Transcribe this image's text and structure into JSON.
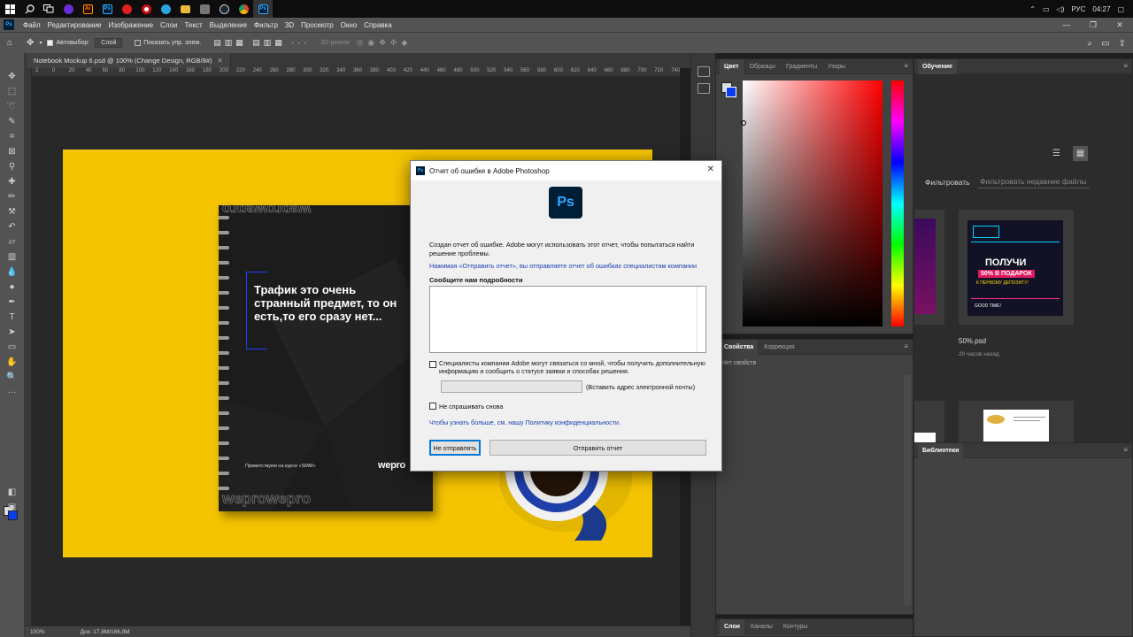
{
  "taskbar": {
    "apps": [
      {
        "icon": "windows-start-icon",
        "color": "#0d0d0d",
        "label": ""
      },
      {
        "icon": "search-icon",
        "color": "#0d0d0d",
        "label": ""
      },
      {
        "icon": "task-view-icon",
        "color": "#0d0d0d",
        "label": ""
      },
      {
        "icon": "app-purple-icon",
        "color": "#6a2bd9",
        "label": ""
      },
      {
        "icon": "illustrator-icon",
        "color": "#330000",
        "label": "Ai"
      },
      {
        "icon": "photoshop-icon",
        "color": "#001e36",
        "label": "Ps"
      },
      {
        "icon": "app-red-icon",
        "color": "#e02020",
        "label": ""
      },
      {
        "icon": "opera-icon",
        "color": "#cc0f16",
        "label": ""
      },
      {
        "icon": "telegram-icon",
        "color": "#2aa3df",
        "label": ""
      },
      {
        "icon": "folder-icon",
        "color": "#e8b93a",
        "label": ""
      },
      {
        "icon": "app-gray-icon",
        "color": "#555555",
        "label": ""
      },
      {
        "icon": "steam-icon",
        "color": "#1b2838",
        "label": ""
      },
      {
        "icon": "chrome-icon",
        "color": "#e0a800",
        "label": ""
      },
      {
        "icon": "photoshop-active-icon",
        "color": "#001e36",
        "label": "Ps"
      }
    ],
    "tray": {
      "lang": "РУС",
      "time": "04:27"
    }
  },
  "menubar": {
    "items": [
      "Файл",
      "Редактирование",
      "Изображение",
      "Слои",
      "Текст",
      "Выделение",
      "Фильтр",
      "3D",
      "Просмотр",
      "Окно",
      "Справка"
    ]
  },
  "optbar": {
    "autoselect": "Автовыбор:",
    "layer_select": "Слой",
    "show_controls": "Показать упр. элем.",
    "mode_3d": "3D-режим:"
  },
  "document": {
    "tab_title": "Notebook Mockup 6.psd @ 100% (Change Design, RGB/8#)",
    "ruler_marks": [
      "2",
      "0",
      "20",
      "40",
      "60",
      "80",
      "100",
      "120",
      "140",
      "160",
      "180",
      "200",
      "220",
      "240",
      "260",
      "280",
      "300",
      "320",
      "340",
      "360",
      "380",
      "400",
      "420",
      "440",
      "460",
      "480",
      "500",
      "520",
      "540",
      "560",
      "580",
      "600",
      "620",
      "640",
      "660",
      "680",
      "700",
      "720",
      "740"
    ]
  },
  "notebook": {
    "title": "Трафик это очень странный предмет, то он есть,то его сразу нет...",
    "subtitle": "Приветствуем на курсе «SMM»",
    "brand": "wepro",
    "watermark_top": "weprowepro",
    "watermark_bottom": "weprowepro"
  },
  "color_panel": {
    "tabs": [
      "Цвет",
      "Образцы",
      "Градиенты",
      "Узоры"
    ],
    "fg_color": "#dcdcdc",
    "bg_color": "#0a3cf0"
  },
  "props_panel": {
    "tabs": [
      "Свойства",
      "Коррекция"
    ],
    "body": "Нет свойств"
  },
  "layers_panel": {
    "tabs": [
      "Слои",
      "Каналы",
      "Контуры"
    ]
  },
  "learn_panel": {
    "tab": "Обучение",
    "filter_label": "Фильтровать",
    "filter_placeholder": "Фильтровать недавние файлы",
    "recent_file_name": "50%.psd",
    "recent_file_time": "20 часов назад",
    "thumb_texts": {
      "line1": "ПОЛУЧИ",
      "line2": "50% В ПОДАРОК",
      "line3": "К ПЕРВОМУ ДЕПОЗИТУ!",
      "line4": "GOOD TIME!"
    }
  },
  "libs_panel": {
    "tab": "Библиотеки"
  },
  "statusbar": {
    "zoom": "100%",
    "doc_size": "Док: 17,8M/166,8M"
  },
  "dialog": {
    "title": "Отчет об ошибке в Adobe Photoshop",
    "logo": "Ps",
    "message": "Создан отчет об ошибке. Adobe могут использовать этот отчет, чтобы попытаться найти решение проблемы.",
    "note": "Нажимая «Отправить отчет», вы отправляете отчет об ошибках специалистам компании",
    "details_label": "Сообщите нам подробности",
    "contact_label": "Специалисты компании Adobe могут связаться со мной, чтобы получить дополнительную информацию и сообщить о статусе заявки и способах решения.",
    "email_label": "(Вставить адрес электронной почты)",
    "dont_ask": "Не спрашивать снова",
    "privacy": "Чтобы узнать больше, см. нашу Политику конфиденциальности.",
    "btn_no": "Не отправлять",
    "btn_send": "Отправить отчет"
  }
}
